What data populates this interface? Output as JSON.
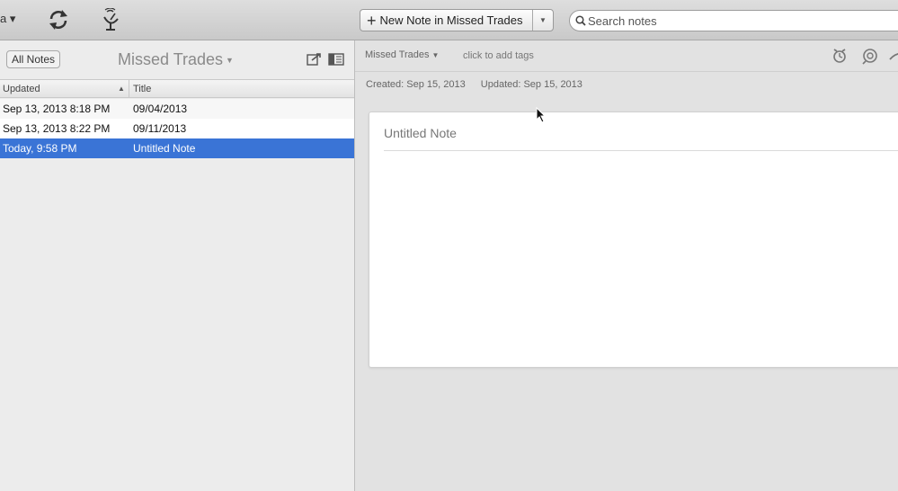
{
  "toolbar": {
    "account_label": "a ▾",
    "sync_icon": "sync-icon",
    "activity_icon": "satellite-icon",
    "new_note_label": "New Note in Missed Trades",
    "search_placeholder": "Search notes"
  },
  "list": {
    "all_notes_label": "All Notes",
    "notebook_title": "Missed Trades",
    "columns": {
      "updated": "Updated",
      "title": "Title"
    },
    "rows": [
      {
        "updated": "Sep 13, 2013 8:18 PM",
        "title": "09/04/2013"
      },
      {
        "updated": "Sep 13, 2013 8:22 PM",
        "title": "09/11/2013"
      },
      {
        "updated": "Today, 9:58 PM",
        "title": "Untitled Note"
      }
    ],
    "selected_index": 2
  },
  "note": {
    "notebook": "Missed Trades",
    "tags_placeholder": "click to add tags",
    "created": "Created: Sep 15, 2013",
    "updated": "Updated: Sep 15, 2013",
    "title_placeholder": "Untitled Note"
  },
  "colors": {
    "selection": "#3a74d6",
    "toolbar": "#d4d4d4"
  }
}
